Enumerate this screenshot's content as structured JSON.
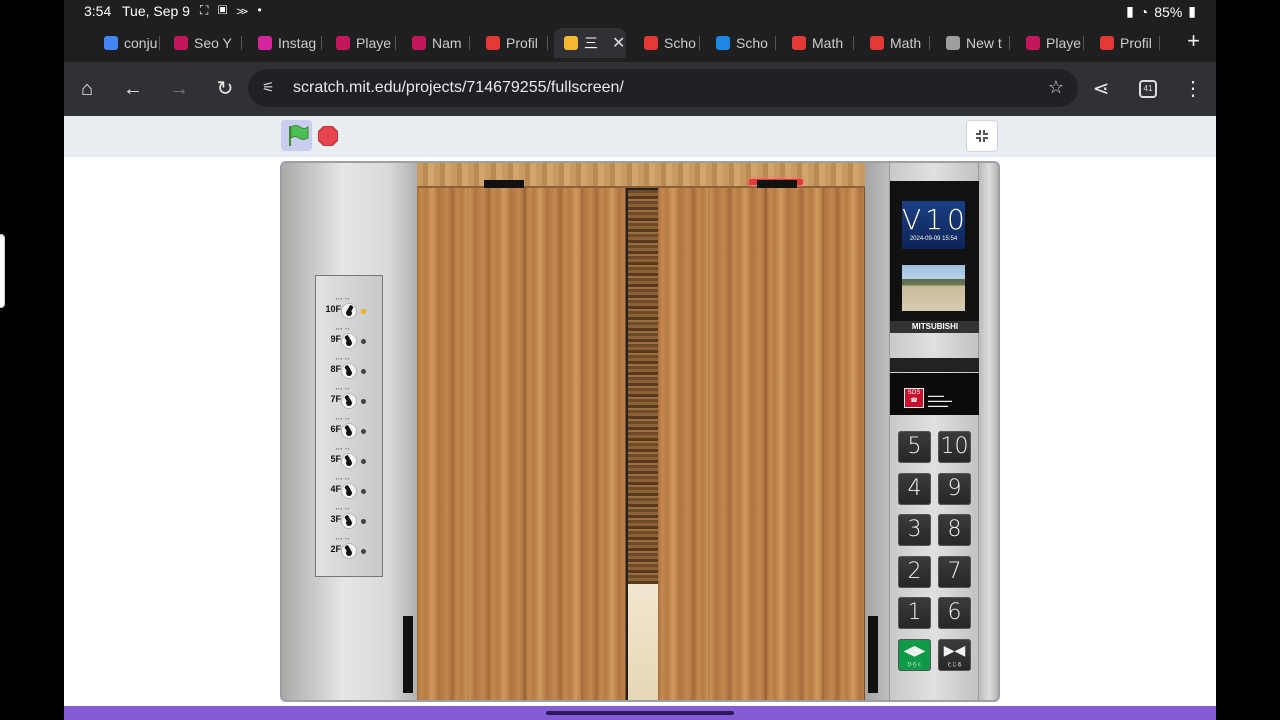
{
  "status_bar": {
    "time": "3:54",
    "date": "Tue, Sep 9",
    "battery": "85%"
  },
  "tabs": [
    {
      "label": "conju",
      "favicon": "google-icon",
      "color": "#4285f4"
    },
    {
      "label": "Seo Y",
      "favicon": "drop-icon",
      "color": "#c2185b"
    },
    {
      "label": "Instag",
      "favicon": "instagram-icon",
      "color": "#d6249f"
    },
    {
      "label": "Playe",
      "favicon": "drop-icon",
      "color": "#c2185b"
    },
    {
      "label": "Nam",
      "favicon": "drop-icon",
      "color": "#c2185b"
    },
    {
      "label": "Profil",
      "favicon": "gate-icon",
      "color": "#e53935"
    },
    {
      "label": "三",
      "favicon": "scratch-icon",
      "color": "#f7b733",
      "active": true
    },
    {
      "label": "Scho",
      "favicon": "s-icon",
      "color": "#e53935"
    },
    {
      "label": "Scho",
      "favicon": "chart-icon",
      "color": "#1e88e5"
    },
    {
      "label": "Math",
      "favicon": "s-icon",
      "color": "#e53935"
    },
    {
      "label": "Math",
      "favicon": "s-icon",
      "color": "#e53935"
    },
    {
      "label": "New t",
      "favicon": "chrome-icon",
      "color": "#9e9e9e"
    },
    {
      "label": "Playe",
      "favicon": "drop-icon",
      "color": "#c2185b"
    },
    {
      "label": "Profil",
      "favicon": "gate-icon",
      "color": "#e53935"
    }
  ],
  "toolbar": {
    "url": "scratch.mit.edu/projects/714679255/fullscreen/",
    "tab_count": "41"
  },
  "scratch": {
    "floor_panel": {
      "floors": [
        {
          "label": "10F",
          "lamp_on": true
        },
        {
          "label": "9F",
          "lamp_on": false
        },
        {
          "label": "8F",
          "lamp_on": false
        },
        {
          "label": "7F",
          "lamp_on": false
        },
        {
          "label": "6F",
          "lamp_on": false
        },
        {
          "label": "5F",
          "lamp_on": false
        },
        {
          "label": "4F",
          "lamp_on": false
        },
        {
          "label": "3F",
          "lamp_on": false
        },
        {
          "label": "2F",
          "lamp_on": false
        }
      ]
    },
    "display": {
      "big_text": "V10",
      "datetime": "2024-09-09  15:54",
      "brand": "MITSUBISHI"
    },
    "sos": {
      "label": "SOS"
    },
    "keypad": {
      "keys": [
        "5",
        "10",
        "4",
        "9",
        "3",
        "8",
        "2",
        "7",
        "1",
        "6"
      ],
      "open_label": "ひらく",
      "close_label": "とじる"
    }
  }
}
